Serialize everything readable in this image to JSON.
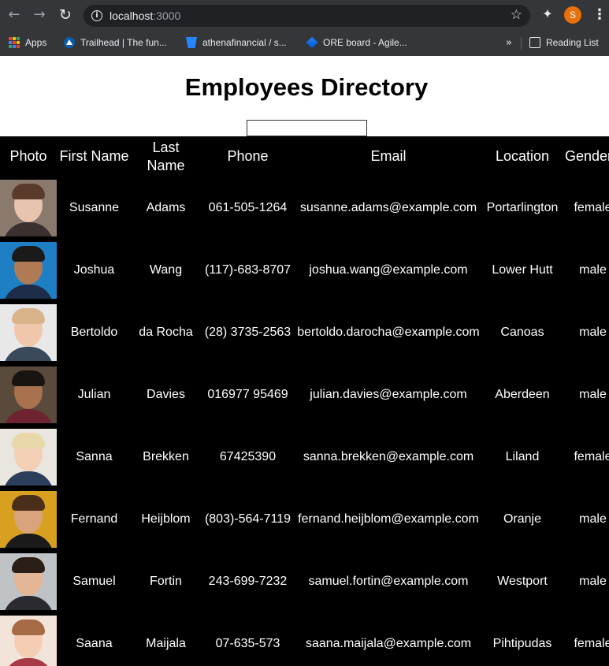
{
  "browser": {
    "url_host": "localhost",
    "url_port": ":3000",
    "profile_initial": "S",
    "bookmarks": [
      {
        "label": "Apps"
      },
      {
        "label": "Trailhead | The fun..."
      },
      {
        "label": "athenafinancial / s..."
      },
      {
        "label": "ORE board - Agile..."
      }
    ],
    "more_label": "»",
    "reading_list_label": "Reading List"
  },
  "page": {
    "title": "Employees Directory",
    "search_value": ""
  },
  "table": {
    "headers": {
      "photo": "Photo",
      "first_name": "First Name",
      "last_name": "Last Name",
      "phone": "Phone",
      "email": "Email",
      "location": "Location",
      "gender": "Gender"
    },
    "rows": [
      {
        "first": "Susanne",
        "last": "Adams",
        "phone": "061-505-1264",
        "email": "susanne.adams@example.com",
        "location": "Portarlington",
        "gender": "female",
        "photo_bg": "#8a7a6e",
        "skin": "#e6c4ae",
        "hair": "#5a3a2a",
        "shirt": "#3a3030"
      },
      {
        "first": "Joshua",
        "last": "Wang",
        "phone": "(117)-683-8707",
        "email": "joshua.wang@example.com",
        "location": "Lower Hutt",
        "gender": "male",
        "photo_bg": "#1f7fc4",
        "skin": "#b07a55",
        "hair": "#1a1a1a",
        "shirt": "#1d2d4a"
      },
      {
        "first": "Bertoldo",
        "last": "da Rocha",
        "phone": "(28) 3735-2563",
        "email": "bertoldo.darocha@example.com",
        "location": "Canoas",
        "gender": "male",
        "photo_bg": "#e8e8e8",
        "skin": "#f0c7aa",
        "hair": "#d9b48a",
        "shirt": "#3a4a5a"
      },
      {
        "first": "Julian",
        "last": "Davies",
        "phone": "016977 95469",
        "email": "julian.davies@example.com",
        "location": "Aberdeen",
        "gender": "male",
        "photo_bg": "#5a4a3c",
        "skin": "#a8724e",
        "hair": "#1a1410",
        "shirt": "#6e2430"
      },
      {
        "first": "Sanna",
        "last": "Brekken",
        "phone": "67425390",
        "email": "sanna.brekken@example.com",
        "location": "Liland",
        "gender": "female",
        "photo_bg": "#e9e6e0",
        "skin": "#f2cfb5",
        "hair": "#e8d7a8",
        "shirt": "#2b3e5a"
      },
      {
        "first": "Fernand",
        "last": "Heijblom",
        "phone": "(803)-564-7119",
        "email": "fernand.heijblom@example.com",
        "location": "Oranje",
        "gender": "male",
        "photo_bg": "#d8a020",
        "skin": "#d9a37c",
        "hair": "#4a2e1a",
        "shirt": "#1a1a1a"
      },
      {
        "first": "Samuel",
        "last": "Fortin",
        "phone": "243-699-7232",
        "email": "samuel.fortin@example.com",
        "location": "Westport",
        "gender": "male",
        "photo_bg": "#bfc3c6",
        "skin": "#e3b696",
        "hair": "#2a1e16",
        "shirt": "#2a2a30"
      },
      {
        "first": "Saana",
        "last": "Maijala",
        "phone": "07-635-573",
        "email": "saana.maijala@example.com",
        "location": "Pihtipudas",
        "gender": "female",
        "photo_bg": "#f3e4da",
        "skin": "#f4cdb4",
        "hair": "#a66a44",
        "shirt": "#a83a48"
      }
    ]
  }
}
